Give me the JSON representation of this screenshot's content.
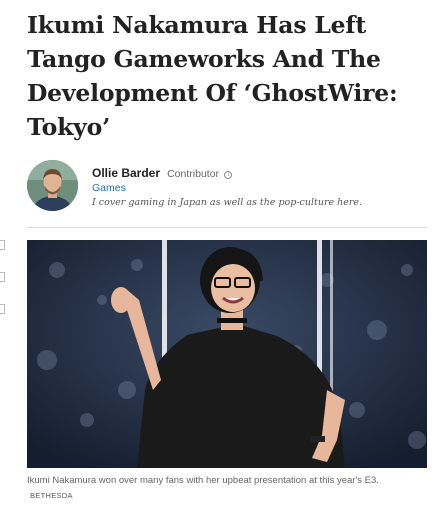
{
  "article": {
    "headline": "Ikumi Nakamura Has Left Tango Gameworks And The Development Of ‘GhostWire: Tokyo’"
  },
  "author": {
    "name": "Ollie Barder",
    "role": "Contributor",
    "section": "Games",
    "bio": "I cover gaming in Japan as well as the pop-culture here.",
    "avatar_icon": "person-avatar"
  },
  "photo": {
    "icon": "presenter-photo",
    "caption": "Ikumi Nakamura won over many fans with her upbeat presentation at this year's E3.",
    "credit": "BETHESDA"
  },
  "colors": {
    "link": "#1d6fbf",
    "stage_background": "#1d2a3e"
  }
}
